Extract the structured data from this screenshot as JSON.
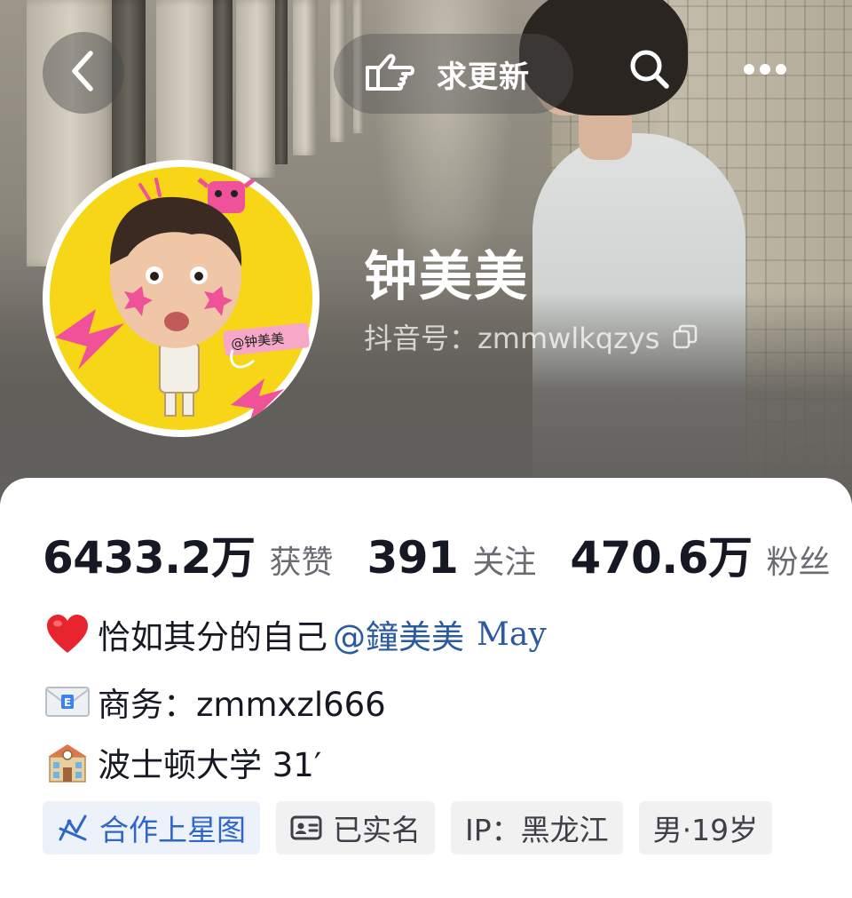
{
  "header": {
    "update_label": "求更新"
  },
  "profile": {
    "name": "钟美美",
    "douyin_id": "抖音号：zmmwlkqzys",
    "avatar_sticker_text": "@钟美美"
  },
  "stats": [
    {
      "value": "6433.2万",
      "label": "获赞"
    },
    {
      "value": "391",
      "label": "关注"
    },
    {
      "value": "470.6万",
      "label": "粉丝"
    }
  ],
  "bio": {
    "line1_text": "恰如其分的自己",
    "line1_mention": "@鐘美美",
    "line1_mention_en": "May",
    "line2": "商务：zmmxzl666",
    "line3": "波士顿大学 31′"
  },
  "tags": [
    {
      "label": "合作上星图"
    },
    {
      "label": "已实名"
    },
    {
      "label": "IP：黑龙江"
    },
    {
      "label": "男·19岁"
    }
  ],
  "colors": {
    "text_primary": "#161823",
    "text_secondary": "#6b6c73",
    "mention_blue": "#2b5aa0",
    "tag_blue": "#2f67c9",
    "avatar_yellow": "#f7d517",
    "sticker_pink": "#f0529a"
  },
  "icons": {
    "back": "chevron-left-icon",
    "update": "pointing-hand-icon",
    "search": "search-icon",
    "more": "more-horizontal-icon",
    "copy": "copy-icon",
    "heart": "red-heart-emoji",
    "mail": "envelope-emoji",
    "school": "school-building-emoji",
    "star_map": "star-map-icon",
    "id_card": "id-card-icon"
  }
}
